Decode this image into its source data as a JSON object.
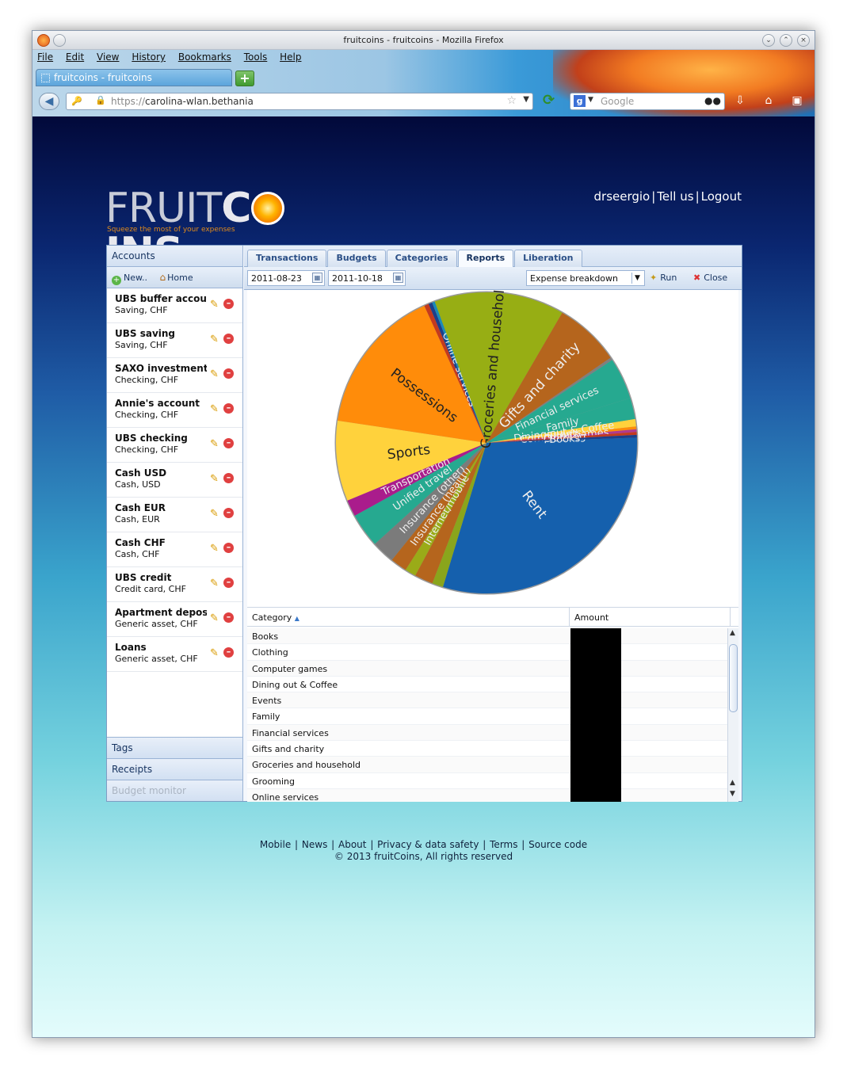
{
  "window": {
    "title": "fruitcoins - fruitcoins - Mozilla Firefox",
    "menu": [
      "File",
      "Edit",
      "View",
      "History",
      "Bookmarks",
      "Tools",
      "Help"
    ],
    "tab_label": "fruitcoins - fruitcoins",
    "url_prefix": "https://",
    "url_host": "carolina-wlan.bethania",
    "search_placeholder": "Google"
  },
  "site": {
    "logo_part1": "FRUIT",
    "logo_part2": "C",
    "logo_part3": "INS",
    "tagline": "Squeeze the most of your expenses",
    "user": "drseergio",
    "tell_us": "Tell us",
    "logout": "Logout"
  },
  "sidebar": {
    "accounts_header": "Accounts",
    "new_label": "New..",
    "home_label": "Home",
    "accounts": [
      {
        "name": "UBS buffer account",
        "type": "Saving, CHF"
      },
      {
        "name": "UBS saving",
        "type": "Saving, CHF"
      },
      {
        "name": "SAXO investments",
        "type": "Checking, CHF"
      },
      {
        "name": "Annie's account",
        "type": "Checking, CHF"
      },
      {
        "name": "UBS checking",
        "type": "Checking, CHF"
      },
      {
        "name": "Cash USD",
        "type": "Cash, USD"
      },
      {
        "name": "Cash EUR",
        "type": "Cash, EUR"
      },
      {
        "name": "Cash CHF",
        "type": "Cash, CHF"
      },
      {
        "name": "UBS credit",
        "type": "Credit card, CHF"
      },
      {
        "name": "Apartment deposit",
        "type": "Generic asset, CHF"
      },
      {
        "name": "Loans",
        "type": "Generic asset, CHF"
      }
    ],
    "bottom": [
      "Tags",
      "Receipts",
      "Budget monitor"
    ]
  },
  "tabs": [
    "Transactions",
    "Budgets",
    "Categories",
    "Reports",
    "Liberation"
  ],
  "active_tab": "Reports",
  "report": {
    "date_from": "2011-08-23",
    "date_to": "2011-10-18",
    "report_type": "Expense breakdown",
    "run_label": "Run",
    "close_label": "Close"
  },
  "chart_data": {
    "type": "pie",
    "title": "",
    "slices": [
      {
        "label": "Rent",
        "value": 30.5,
        "color": "#1560ad"
      },
      {
        "label": "",
        "value": 1.2,
        "color": "#8aa51c"
      },
      {
        "label": "",
        "value": 2.0,
        "color": "#b5651d"
      },
      {
        "label": "Internet/mobile",
        "value": 1.2,
        "color": "#9aab18"
      },
      {
        "label": "Insurance (health)",
        "value": 1.8,
        "color": "#b5651d"
      },
      {
        "label": "Insurance (other)",
        "value": 2.5,
        "color": "#7b7b7b"
      },
      {
        "label": "Unified travel",
        "value": 3.7,
        "color": "#26a990"
      },
      {
        "label": "Transportation",
        "value": 1.8,
        "color": "#aa1c8c"
      },
      {
        "label": "Sports",
        "value": 8.7,
        "color": "#ffd23c"
      },
      {
        "label": "Possessions",
        "value": 16.0,
        "color": "#ff8c0a"
      },
      {
        "label": "",
        "value": 0.5,
        "color": "#c43a1e"
      },
      {
        "label": "",
        "value": 0.4,
        "color": "#1d3f8a"
      },
      {
        "label": "Online services",
        "value": 0.3,
        "color": "#1a8ab8"
      },
      {
        "label": "Groceries and household",
        "value": 14.1,
        "color": "#97ae14"
      },
      {
        "label": "Gifts and charity",
        "value": 7.1,
        "color": "#b5651d"
      },
      {
        "label": "",
        "value": 0.3,
        "color": "#7f7f7f"
      },
      {
        "label": "Financial services",
        "value": 4.5,
        "color": "#26a990"
      },
      {
        "label": "Family",
        "value": 2.3,
        "color": "#26a990"
      },
      {
        "label": "Dining out & Coffee",
        "value": 0.8,
        "color": "#ffd23c"
      },
      {
        "label": "Events",
        "value": 0.3,
        "color": "#ff8c0a"
      },
      {
        "label": "Computer games",
        "value": 0.3,
        "color": "#b03a8e"
      },
      {
        "label": "Clothing",
        "value": 0.3,
        "color": "#c43a1e"
      },
      {
        "label": "Books",
        "value": 0.3,
        "color": "#1d3f8a"
      }
    ]
  },
  "grid": {
    "col_category": "Category",
    "col_amount": "Amount",
    "rows": [
      "Books",
      "Clothing",
      "Computer games",
      "Dining out & Coffee",
      "Events",
      "Family",
      "Financial services",
      "Gifts and charity",
      "Groceries and household",
      "Grooming",
      "Online services"
    ]
  },
  "footer": {
    "links": [
      "Mobile",
      "News",
      "About",
      "Privacy & data safety",
      "Terms",
      "Source code"
    ],
    "copyright": "© 2013 fruitCoins, All rights reserved"
  }
}
